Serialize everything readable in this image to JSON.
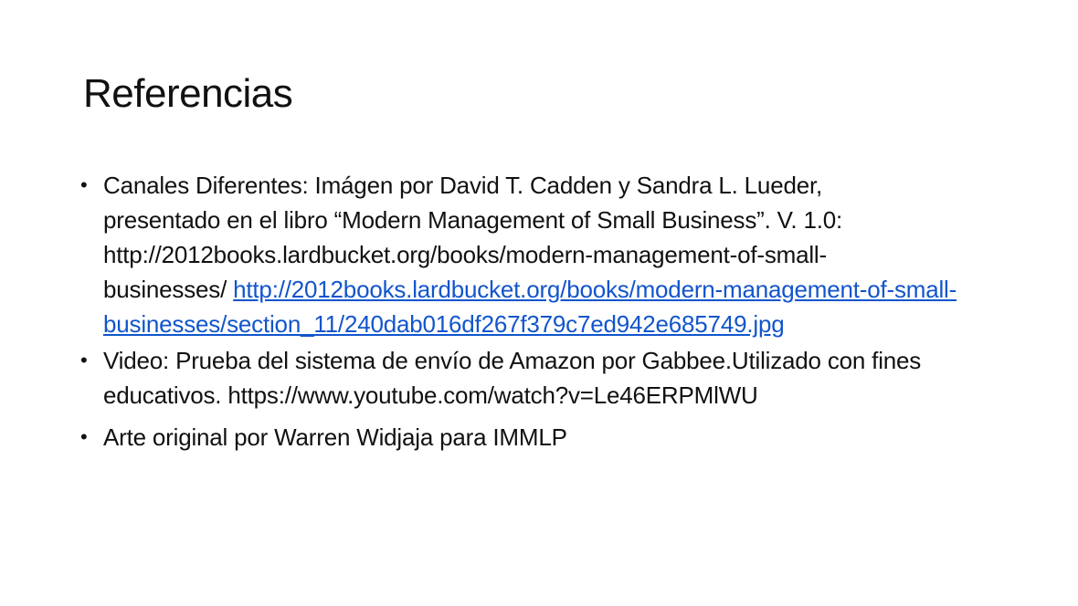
{
  "slide": {
    "title": "Referencias",
    "references": [
      {
        "text_line1": "Canales Diferentes: Imágen por David T. Cadden y Sandra L. Lueder,",
        "text_line2": "presentado en el libro “Modern Management of Small Business”. V. 1.0:",
        "text_line3": "http://2012books.lardbucket.org/books/modern-management-of-small-",
        "text_line4": "businesses/ ",
        "link": "http://2012books.lardbucket.org/books/modern-management-of-small-businesses/section_11/240dab016df267f379c7ed942e685749.jpg"
      },
      {
        "text": "Video: Prueba del sistema de envío de Amazon por Gabbee.Utilizado con fines educativos.  https://www.youtube.com/watch?v=Le46ERPMlWU"
      },
      {
        "text": "Arte original por Warren Widjaja para IMMLP"
      }
    ],
    "bullet_glyph": "•",
    "colors": {
      "text": "#111111",
      "link": "#1155cc",
      "background": "#ffffff"
    }
  }
}
